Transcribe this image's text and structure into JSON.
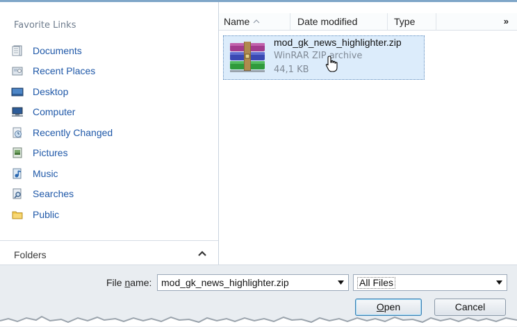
{
  "nav": {
    "title": "Favorite Links",
    "items": [
      {
        "label": "Documents",
        "icon": "documents-icon"
      },
      {
        "label": "Recent Places",
        "icon": "recent-places-icon"
      },
      {
        "label": "Desktop",
        "icon": "desktop-icon"
      },
      {
        "label": "Computer",
        "icon": "computer-icon"
      },
      {
        "label": "Recently Changed",
        "icon": "recently-changed-icon"
      },
      {
        "label": "Pictures",
        "icon": "pictures-icon"
      },
      {
        "label": "Music",
        "icon": "music-icon"
      },
      {
        "label": "Searches",
        "icon": "searches-icon"
      },
      {
        "label": "Public",
        "icon": "public-folder-icon"
      }
    ],
    "folders_label": "Folders"
  },
  "columns": {
    "name": "Name",
    "date": "Date modified",
    "type": "Type",
    "more": "»"
  },
  "file": {
    "name": "mod_gk_news_highlighter.zip",
    "type": "WinRAR ZIP archive",
    "size": "44,1 KB",
    "icon": "winrar-archive-icon"
  },
  "bottom": {
    "filename_label_pre": "File ",
    "filename_label_accel": "n",
    "filename_label_post": "ame:",
    "filename_value": "mod_gk_news_highlighter.zip",
    "filter_value": "All Files",
    "open_accel": "O",
    "open_rest": "pen",
    "cancel_label": "Cancel"
  },
  "colors": {
    "link_blue": "#1f58a8",
    "selection_bg": "#dcecfb",
    "dialog_bg": "#e9edf1"
  }
}
